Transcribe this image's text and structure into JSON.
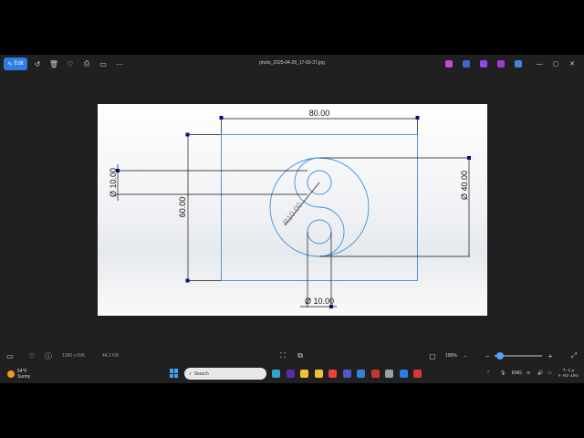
{
  "viewer": {
    "edit_label": "Edit",
    "filename": "photo_2025-04-28_17-59-37.jpg",
    "toolbar_icons": [
      "rotate-icon",
      "delete-icon",
      "favorite-icon",
      "print-icon",
      "more-icon"
    ],
    "app_icons": [
      {
        "name": "app-icon-photos",
        "color": "#c24bd9"
      },
      {
        "name": "app-icon-clipchamp",
        "color": "#3a67d8"
      },
      {
        "name": "app-icon-designer",
        "color": "#8a4ee6"
      },
      {
        "name": "app-icon-purple",
        "color": "#a23ad2"
      },
      {
        "name": "app-icon-cloud",
        "color": "#3c87d8"
      }
    ]
  },
  "drawing": {
    "dims": {
      "width": "80.00",
      "height": "60.00",
      "dia_left": "Ø 10.00",
      "dia_right": "Ø 40.00",
      "dia_bottom": "Ø 10.00",
      "radius": "R10.00"
    },
    "colors": {
      "geometry": "#3d8fd8",
      "dimension": "#111111",
      "point": "#0a0a80"
    }
  },
  "status": {
    "resolution": "1280 x 696",
    "size": "44.2 KB",
    "zoom": "100%",
    "zoom_level": 0.12
  },
  "taskbar": {
    "weather_temp": "54°F",
    "weather_cond": "Sunny",
    "search_placeholder": "Search",
    "language": "ENG",
    "time": "ﻡ ٦:٠٤",
    "date": "٢٠٢٥/٠٤/٢٨",
    "pinned": [
      {
        "name": "taskbar-icon-copilot",
        "color": "#2fa3c8"
      },
      {
        "name": "taskbar-icon-media",
        "color": "#5b2da6"
      },
      {
        "name": "taskbar-icon-explorer",
        "color": "#f2c12e"
      },
      {
        "name": "taskbar-icon-files",
        "color": "#f2c12e"
      },
      {
        "name": "taskbar-icon-chrome",
        "color": "#e8463a"
      },
      {
        "name": "taskbar-icon-teams",
        "color": "#5059c9"
      },
      {
        "name": "taskbar-icon-store",
        "color": "#3a80d9"
      },
      {
        "name": "taskbar-icon-solidworks",
        "color": "#c9372c"
      },
      {
        "name": "taskbar-icon-user",
        "color": "#9aa0a6"
      },
      {
        "name": "taskbar-icon-photos",
        "color": "#2b7de9"
      },
      {
        "name": "taskbar-icon-record",
        "color": "#d9363e"
      }
    ]
  }
}
